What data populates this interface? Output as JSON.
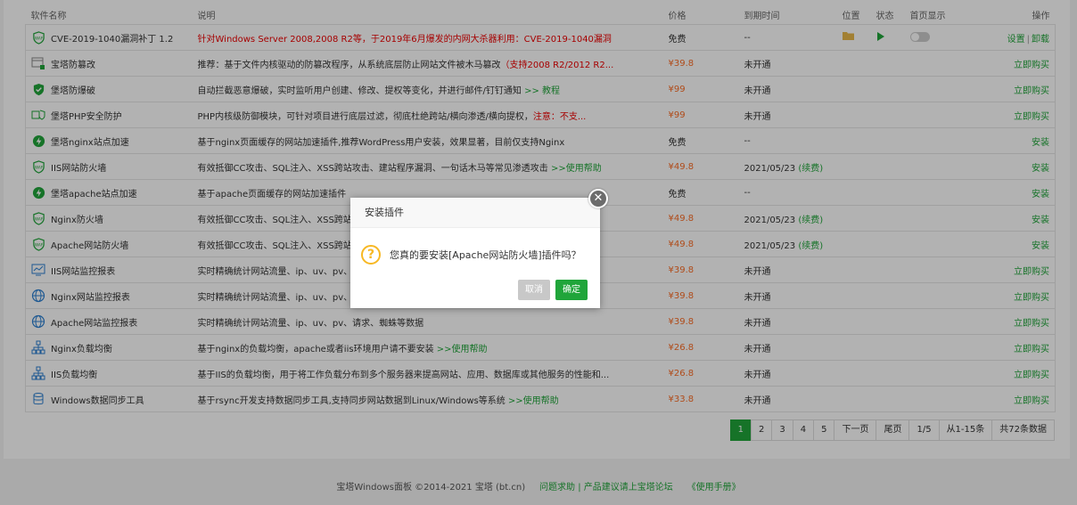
{
  "table": {
    "headers": {
      "name": "软件名称",
      "desc": "说明",
      "price": "价格",
      "expire": "到期时间",
      "location": "位置",
      "status": "状态",
      "homepage": "首页显示",
      "ops": "操作"
    },
    "rows": [
      {
        "name": "CVE-2019-1040漏洞补丁 1.2",
        "icon": "waf-shield-icon",
        "desc": "针对Windows Server 2008,2008 R2等，于2019年6月爆发的内网大杀器利用：CVE-2019-1040漏洞",
        "desc_red": "",
        "desc_link": "",
        "price": "免费",
        "expire": "--",
        "expire_link": "",
        "has_folder": true,
        "has_play": true,
        "has_toggle": true,
        "op": "设置",
        "op2": "卸载"
      },
      {
        "name": "宝塔防篡改",
        "icon": "tamper-lock-icon",
        "desc": "推荐：基于文件内核驱动的防篡改程序，从系统底层防止网站文件被木马篡改",
        "desc_red": "（支持2008 R2/2012 R2...",
        "desc_link": "",
        "price": "¥39.8",
        "expire": "未开通",
        "expire_link": "",
        "op": "立即购买"
      },
      {
        "name": "堡塔防爆破",
        "icon": "shield-check-icon",
        "desc": "自动拦截恶意爆破，实时监听用户创建、修改、提权等变化，并进行邮件/钉钉通知",
        "desc_red": "",
        "desc_link": ">> 教程",
        "price": "¥99",
        "expire": "未开通",
        "expire_link": "",
        "op": "立即购买"
      },
      {
        "name": "堡塔PHP安全防护",
        "icon": "php-shield-icon",
        "desc": "PHP内核级防御模块，可针对项目进行底层过滤，彻底杜绝跨站/横向渗透/横向提权，",
        "desc_red": "注意：不支...",
        "desc_link": "",
        "price": "¥99",
        "expire": "未开通",
        "expire_link": "",
        "op": "立即购买"
      },
      {
        "name": "堡塔nginx站点加速",
        "icon": "lightning-icon",
        "desc": "基于nginx页面缓存的网站加速插件,推荐WordPress用户安装，效果显著，目前仅支持Nginx",
        "desc_red": "",
        "desc_link": "",
        "price": "免费",
        "expire": "--",
        "expire_link": "",
        "op": "安装"
      },
      {
        "name": "IIS网站防火墙",
        "icon": "waf-shield-icon",
        "desc": "有效抵御CC攻击、SQL注入、XSS跨站攻击、建站程序漏洞、一句话木马等常见渗透攻击",
        "desc_red": "",
        "desc_link": ">>使用帮助",
        "price": "¥49.8",
        "expire": "2021/05/23",
        "expire_link": "(续费)",
        "op": "安装"
      },
      {
        "name": "堡塔apache站点加速",
        "icon": "lightning-icon",
        "desc": "基于apache页面缓存的网站加速插件",
        "desc_red": "",
        "desc_link": "",
        "price": "免费",
        "expire": "--",
        "expire_link": "",
        "op": "安装"
      },
      {
        "name": "Nginx防火墙",
        "icon": "waf-shield-icon",
        "desc": "有效抵御CC攻击、SQL注入、XSS跨站",
        "desc_red": "",
        "desc_link": "",
        "price": "¥49.8",
        "expire": "2021/05/23",
        "expire_link": "(续费)",
        "op": "安装"
      },
      {
        "name": "Apache网站防火墙",
        "icon": "waf-shield-icon",
        "desc": "有效抵御CC攻击、SQL注入、XSS跨站",
        "desc_red": "",
        "desc_link": "",
        "price": "¥49.8",
        "expire": "2021/05/23",
        "expire_link": "(续费)",
        "op": "安装"
      },
      {
        "name": "IIS网站监控报表",
        "icon": "monitor-chart-icon",
        "desc": "实时精确统计网站流量、ip、uv、pv、请",
        "desc_red": "",
        "desc_link": "",
        "price": "¥39.8",
        "expire": "未开通",
        "expire_link": "",
        "op": "立即购买"
      },
      {
        "name": "Nginx网站监控报表",
        "icon": "globe-icon",
        "desc": "实时精确统计网站流量、ip、uv、pv、请",
        "desc_red": "",
        "desc_link": "",
        "price": "¥39.8",
        "expire": "未开通",
        "expire_link": "",
        "op": "立即购买"
      },
      {
        "name": "Apache网站监控报表",
        "icon": "globe-icon",
        "desc": "实时精确统计网站流量、ip、uv、pv、请求、蜘蛛等数据",
        "desc_red": "",
        "desc_link": "",
        "price": "¥39.8",
        "expire": "未开通",
        "expire_link": "",
        "op": "立即购买"
      },
      {
        "name": "Nginx负载均衡",
        "icon": "network-icon",
        "desc": "基于nginx的负载均衡，apache或者iis环境用户请不要安装",
        "desc_red": "",
        "desc_link": ">>使用帮助",
        "price": "¥26.8",
        "expire": "未开通",
        "expire_link": "",
        "op": "立即购买"
      },
      {
        "name": "IIS负载均衡",
        "icon": "network-icon",
        "desc": "基于IIS的负载均衡，用于将工作负载分布到多个服务器来提高网站、应用、数据库或其他服务的性能和...",
        "desc_red": "",
        "desc_link": "",
        "price": "¥26.8",
        "expire": "未开通",
        "expire_link": "",
        "op": "立即购买"
      },
      {
        "name": "Windows数据同步工具",
        "icon": "database-sync-icon",
        "desc": "基于rsync开发支持数据同步工具,支持同步网站数据到Linux/Windows等系统",
        "desc_red": "",
        "desc_link": ">>使用帮助",
        "price": "¥33.8",
        "expire": "未开通",
        "expire_link": "",
        "op": "立即购买"
      }
    ]
  },
  "pagination": {
    "pages": [
      "1",
      "2",
      "3",
      "4",
      "5"
    ],
    "current": "1",
    "next": "下一页",
    "last": "尾页",
    "page_info": "1/5",
    "range_info": "从1-15条",
    "total_info": "共72条数据"
  },
  "footer": {
    "copyright": "宝塔Windows面板 ©2014-2021 宝塔 (bt.cn)",
    "help_link": "问题求助 | 产品建议请上宝塔论坛",
    "manual_link": "《使用手册》"
  },
  "dialog": {
    "title": "安装插件",
    "message": "您真的要安装[Apache网站防火墙]插件吗？",
    "cancel": "取消",
    "confirm": "确定",
    "icon": "question-icon",
    "close_icon": "close-icon"
  },
  "colors": {
    "accent": "#20a53a",
    "price": "#fc6d26",
    "danger": "#ee0000",
    "question": "#f7b824"
  }
}
